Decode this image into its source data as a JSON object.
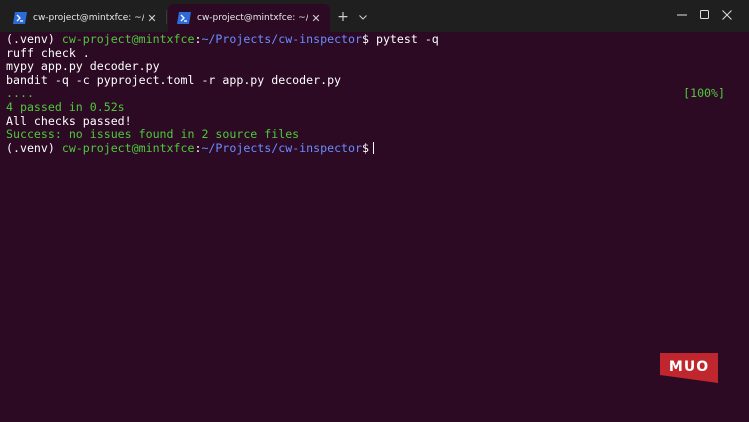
{
  "tabs": [
    {
      "label": "cw-project@mintxfce: ~/Proje",
      "active": false
    },
    {
      "label": "cw-project@mintxfce: ~/Proje",
      "active": true
    }
  ],
  "tabbar": {
    "new_tab_label": "+"
  },
  "terminal": {
    "line1": {
      "venv": "(.venv) ",
      "user": "cw-project@mintxfce",
      "colon": ":",
      "path": "~/Projects/cw-inspector",
      "prompt": "$ ",
      "command": "pytest -q"
    },
    "line2": "ruff check .",
    "line3": "mypy app.py decoder.py",
    "line4": "bandit -q -c pyproject.toml -r app.py decoder.py",
    "line5": {
      "dots": "....",
      "percent": "[100%]"
    },
    "line6": "4 passed in 0.52s",
    "line7": "All checks passed!",
    "line8": "Success: no issues found in 2 source files",
    "line9": {
      "venv": "(.venv) ",
      "user": "cw-project@mintxfce",
      "colon": ":",
      "path": "~/Projects/cw-inspector",
      "prompt": "$"
    }
  },
  "watermark": {
    "text": "MUO"
  },
  "colors": {
    "background": "#2c0a24",
    "titlebar": "#1f1f1f",
    "green": "#4ec93a",
    "blue": "#6b8cff",
    "watermark": "#c0262d"
  }
}
